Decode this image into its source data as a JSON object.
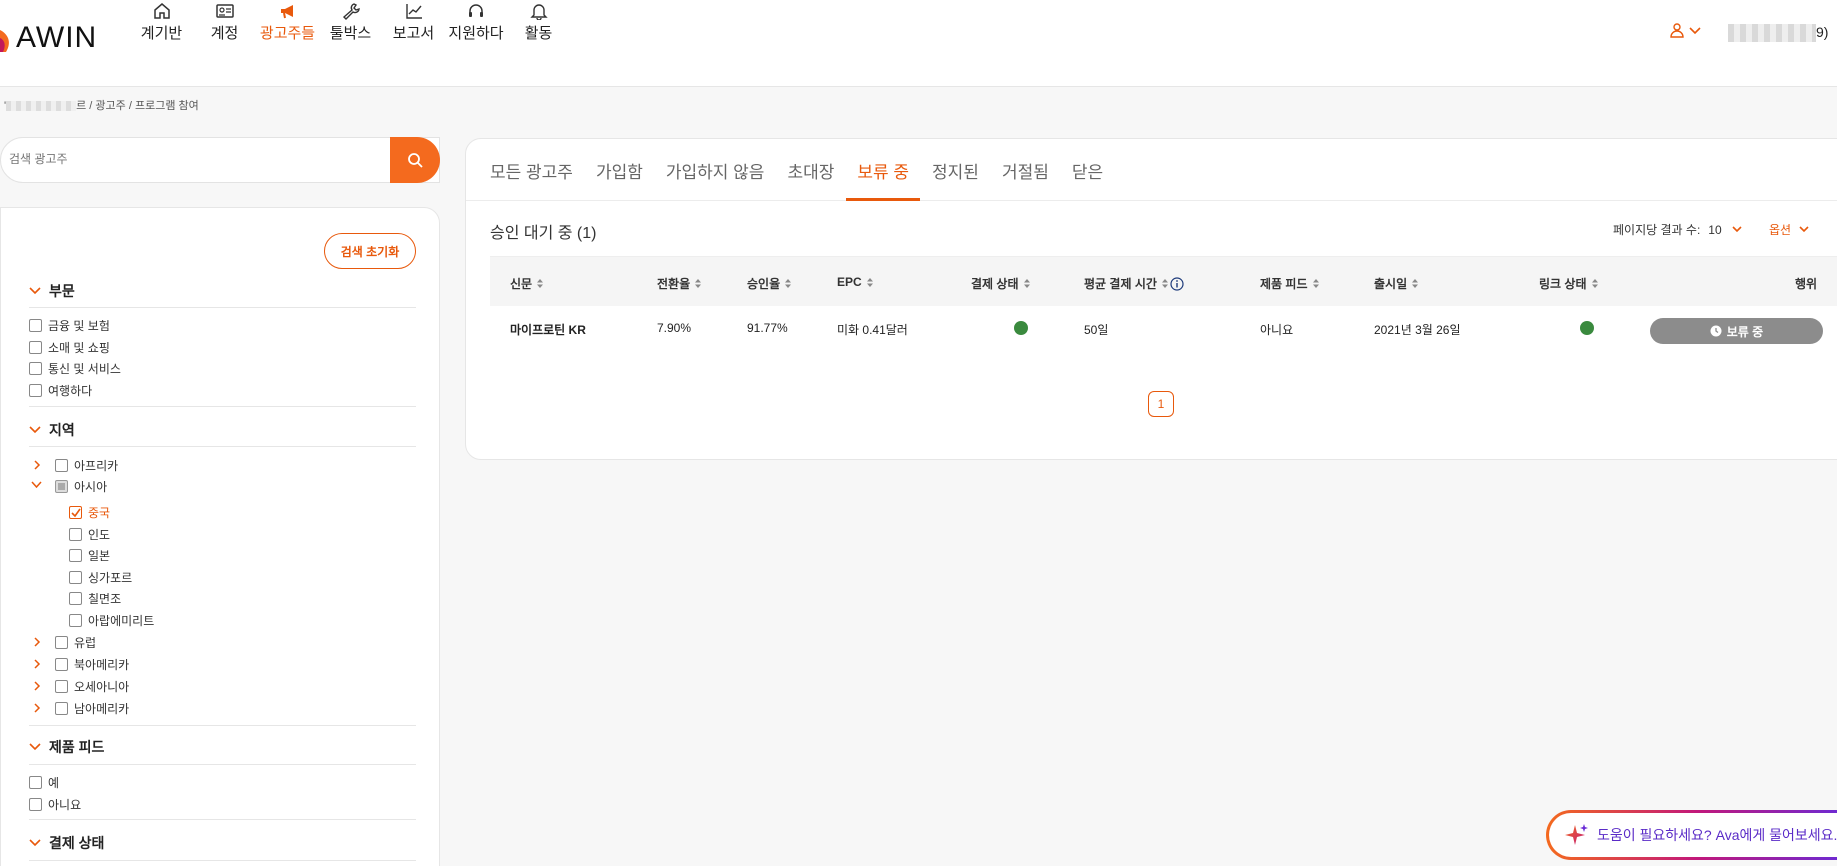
{
  "header": {
    "logo_text": "AWIN",
    "nav": [
      {
        "label": "계기반",
        "icon": "home-icon"
      },
      {
        "label": "계정",
        "icon": "id-card-icon"
      },
      {
        "label": "광고주들",
        "icon": "megaphone-icon",
        "active": true
      },
      {
        "label": "툴박스",
        "icon": "wrench-icon"
      },
      {
        "label": "보고서",
        "icon": "chart-icon"
      },
      {
        "label": "지원하다",
        "icon": "headset-icon"
      },
      {
        "label": "활동",
        "icon": "bell-icon"
      }
    ],
    "user_suffix": "9)"
  },
  "breadcrumb": {
    "first": "'",
    "first_tail": "르",
    "sep": "/",
    "second": "광고주",
    "third": "프로그램 참여"
  },
  "search": {
    "placeholder": "검색 광고주"
  },
  "filters": {
    "reset_label": "검색 초기화",
    "sector": {
      "title": "부문",
      "items": [
        "금융 및 보험",
        "소매 및 쇼핑",
        "통신 및 서비스",
        "여행하다"
      ]
    },
    "region": {
      "title": "지역",
      "top": [
        {
          "label": "아프리카",
          "expanded": false
        },
        {
          "label": "아시아",
          "expanded": true
        }
      ],
      "asia": [
        {
          "label": "중국",
          "checked": true
        },
        {
          "label": "인도",
          "checked": false
        },
        {
          "label": "일본",
          "checked": false
        },
        {
          "label": "싱가포르",
          "checked": false
        },
        {
          "label": "칠면조",
          "checked": false
        },
        {
          "label": "아랍에미리트",
          "checked": false
        }
      ],
      "rest": [
        "유럽",
        "북아메리카",
        "오세아니아",
        "남아메리카"
      ]
    },
    "product_feed": {
      "title": "제품 피드",
      "items": [
        "예",
        "아니요"
      ]
    },
    "payment_status": {
      "title": "결제 상태"
    }
  },
  "tabs": [
    "모든 광고주",
    "가입함",
    "가입하지 않음",
    "초대장",
    "보류 중",
    "정지된",
    "거절됨",
    "닫은"
  ],
  "active_tab": "보류 중",
  "results": {
    "title": "승인 대기 중 (1)",
    "per_page_label": "페이지당 결과 수:",
    "per_page_value": "10",
    "options_label": "옵션"
  },
  "table": {
    "headers": [
      "신문",
      "전환율",
      "승인율",
      "EPC",
      "결제 상태",
      "평균 결제 시간",
      "제품 피드",
      "출시일",
      "링크 상태",
      "행위"
    ],
    "row": {
      "name": "마이프로틴 KR",
      "conversion": "7.90%",
      "approval": "91.77%",
      "epc": "미화 0.41달러",
      "payment_status": "green",
      "avg_payment_time": "50일",
      "product_feed": "아니요",
      "launch_date": "2021년 3월 26일",
      "link_status": "green",
      "action": "보류 중"
    }
  },
  "pagination": {
    "current": "1"
  },
  "help": {
    "text": "도움이 필요하세요? Ava에게 물어보세요."
  },
  "colors": {
    "accent": "#e8590c",
    "status_green": "#3a8a3e",
    "pending_grey": "#8c8c8c"
  }
}
